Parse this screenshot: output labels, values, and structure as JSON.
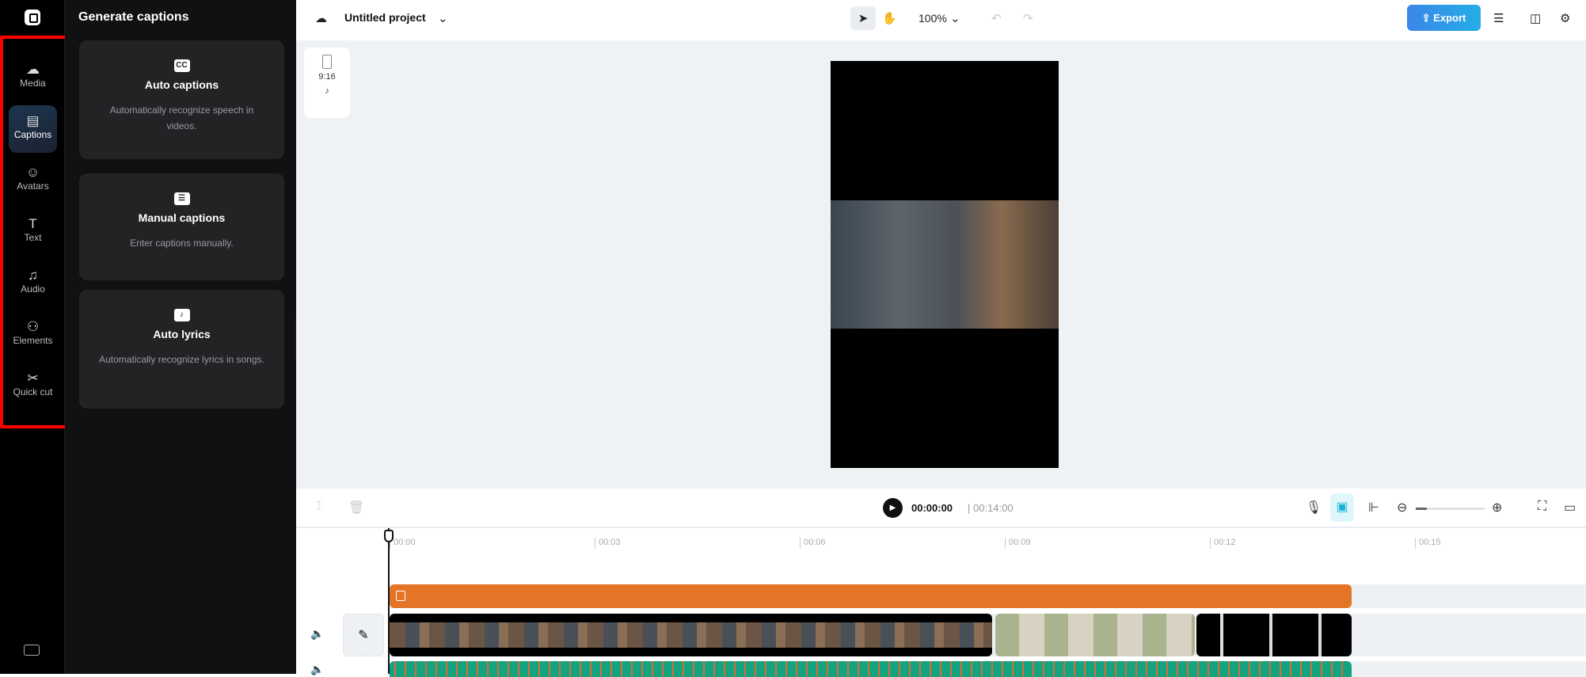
{
  "sidebar": {
    "items": [
      {
        "label": "Media",
        "icon": "cloud-upload-icon"
      },
      {
        "label": "Captions",
        "icon": "captions-icon",
        "active": true
      },
      {
        "label": "Avatars",
        "icon": "avatar-icon"
      },
      {
        "label": "Text",
        "icon": "text-icon"
      },
      {
        "label": "Audio",
        "icon": "music-icon"
      },
      {
        "label": "Elements",
        "icon": "elements-icon"
      },
      {
        "label": "Quick cut",
        "icon": "quick-cut-icon"
      }
    ]
  },
  "panel": {
    "title": "Generate captions",
    "cards": [
      {
        "title": "Auto captions",
        "desc": "Automatically recognize speech in videos.",
        "icon": "CC"
      },
      {
        "title": "Manual captions",
        "desc": "Enter captions manually.",
        "icon": "☰"
      },
      {
        "title": "Auto lyrics",
        "desc": "Automatically recognize lyrics in songs.",
        "icon": "♪"
      }
    ]
  },
  "header": {
    "project": "Untitled project",
    "zoom": "100%",
    "export": "Export"
  },
  "canvas": {
    "aspect": "9:16"
  },
  "player": {
    "current": "00:00:00",
    "duration": "00:14:00"
  },
  "timeline": {
    "ticks": [
      "00:00",
      "00:03",
      "00:06",
      "00:09",
      "00:12",
      "00:15"
    ]
  },
  "colors": {
    "accent": "#2f8fe8",
    "orange": "#e57526",
    "highlight": "#ff0000"
  }
}
